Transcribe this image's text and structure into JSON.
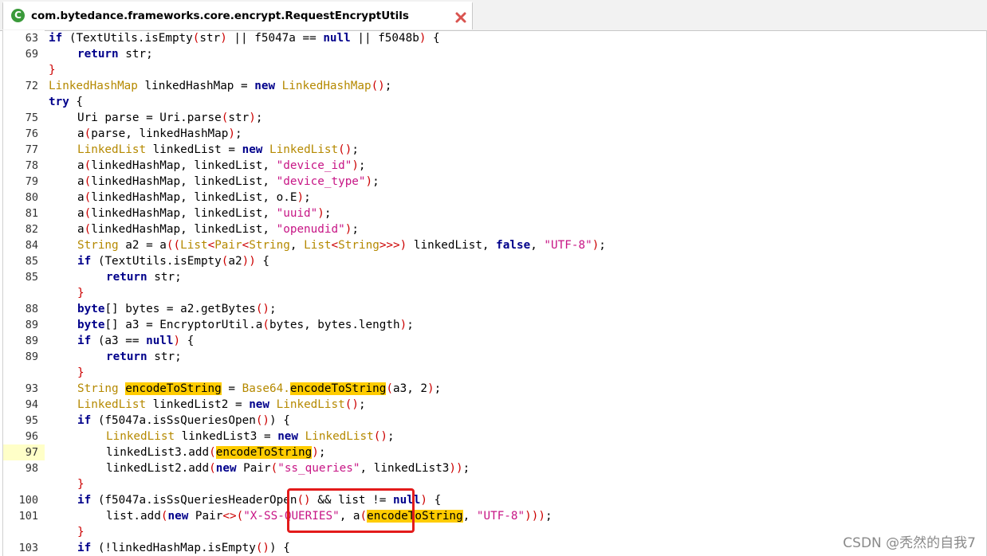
{
  "tab": {
    "title": "com.bytedance.frameworks.core.encrypt.RequestEncryptUtils",
    "icon": "class-icon",
    "close_icon": "close-icon"
  },
  "watermark": "CSDN @秃然的自我7",
  "colors": {
    "keyword": "#00008b",
    "type": "#b58900",
    "string": "#c71585",
    "highlight": "#ffcc00",
    "annotation_box": "#e31b1b"
  },
  "lines": [
    {
      "ln": "63",
      "i": 2,
      "t": [
        [
          "kw",
          "if"
        ],
        [
          "pl",
          " ("
        ],
        [
          "pl",
          "TextUtils.isEmpty"
        ],
        [
          "br",
          "("
        ],
        [
          "pl",
          "str"
        ],
        [
          "br",
          ")"
        ],
        [
          "pl",
          " || f5047a == "
        ],
        [
          "kw",
          "null"
        ],
        [
          "pl",
          " || f5048b"
        ],
        [
          "br",
          ")"
        ],
        [
          "pl",
          " {"
        ]
      ]
    },
    {
      "ln": "69",
      "i": 3,
      "t": [
        [
          "kw",
          "return"
        ],
        [
          "pl",
          " str;"
        ]
      ]
    },
    {
      "ln": "",
      "i": 2,
      "t": [
        [
          "br",
          "}"
        ]
      ]
    },
    {
      "ln": "72",
      "i": 2,
      "t": [
        [
          "ty",
          "LinkedHashMap"
        ],
        [
          "pl",
          " linkedHashMap = "
        ],
        [
          "kw",
          "new"
        ],
        [
          "pl",
          " "
        ],
        [
          "ty",
          "LinkedHashMap"
        ],
        [
          "br",
          "()"
        ],
        [
          "pl",
          ";"
        ]
      ]
    },
    {
      "ln": "",
      "i": 2,
      "t": [
        [
          "kw",
          "try"
        ],
        [
          "pl",
          " {"
        ]
      ]
    },
    {
      "ln": "75",
      "i": 3,
      "t": [
        [
          "pl",
          "Uri parse = Uri.parse"
        ],
        [
          "br",
          "("
        ],
        [
          "pl",
          "str"
        ],
        [
          "br",
          ")"
        ],
        [
          "pl",
          ";"
        ]
      ]
    },
    {
      "ln": "76",
      "i": 3,
      "t": [
        [
          "pl",
          "a"
        ],
        [
          "br",
          "("
        ],
        [
          "pl",
          "parse, linkedHashMap"
        ],
        [
          "br",
          ")"
        ],
        [
          "pl",
          ";"
        ]
      ]
    },
    {
      "ln": "77",
      "i": 3,
      "t": [
        [
          "ty",
          "LinkedList"
        ],
        [
          "pl",
          " linkedList = "
        ],
        [
          "kw",
          "new"
        ],
        [
          "pl",
          " "
        ],
        [
          "ty",
          "LinkedList"
        ],
        [
          "br",
          "()"
        ],
        [
          "pl",
          ";"
        ]
      ]
    },
    {
      "ln": "78",
      "i": 3,
      "t": [
        [
          "pl",
          "a"
        ],
        [
          "br",
          "("
        ],
        [
          "pl",
          "linkedHashMap, linkedList, "
        ],
        [
          "str",
          "\"device_id\""
        ],
        [
          "br",
          ")"
        ],
        [
          "pl",
          ";"
        ]
      ]
    },
    {
      "ln": "79",
      "i": 3,
      "t": [
        [
          "pl",
          "a"
        ],
        [
          "br",
          "("
        ],
        [
          "pl",
          "linkedHashMap, linkedList, "
        ],
        [
          "str",
          "\"device_type\""
        ],
        [
          "br",
          ")"
        ],
        [
          "pl",
          ";"
        ]
      ]
    },
    {
      "ln": "80",
      "i": 3,
      "t": [
        [
          "pl",
          "a"
        ],
        [
          "br",
          "("
        ],
        [
          "pl",
          "linkedHashMap, linkedList, o.E"
        ],
        [
          "br",
          ")"
        ],
        [
          "pl",
          ";"
        ]
      ]
    },
    {
      "ln": "81",
      "i": 3,
      "t": [
        [
          "pl",
          "a"
        ],
        [
          "br",
          "("
        ],
        [
          "pl",
          "linkedHashMap, linkedList, "
        ],
        [
          "str",
          "\"uuid\""
        ],
        [
          "br",
          ")"
        ],
        [
          "pl",
          ";"
        ]
      ]
    },
    {
      "ln": "82",
      "i": 3,
      "t": [
        [
          "pl",
          "a"
        ],
        [
          "br",
          "("
        ],
        [
          "pl",
          "linkedHashMap, linkedList, "
        ],
        [
          "str",
          "\"openudid\""
        ],
        [
          "br",
          ")"
        ],
        [
          "pl",
          ";"
        ]
      ]
    },
    {
      "ln": "84",
      "i": 3,
      "t": [
        [
          "ty",
          "String"
        ],
        [
          "pl",
          " a2 = a"
        ],
        [
          "br",
          "(("
        ],
        [
          "ty",
          "List"
        ],
        [
          "br",
          "<"
        ],
        [
          "ty",
          "Pair"
        ],
        [
          "br",
          "<"
        ],
        [
          "ty",
          "String"
        ],
        [
          "pl",
          ", "
        ],
        [
          "ty",
          "List"
        ],
        [
          "br",
          "<"
        ],
        [
          "ty",
          "String"
        ],
        [
          "br",
          ">>>)"
        ],
        [
          "pl",
          " linkedList, "
        ],
        [
          "kw",
          "false"
        ],
        [
          "pl",
          ", "
        ],
        [
          "str",
          "\"UTF-8\""
        ],
        [
          "br",
          ")"
        ],
        [
          "pl",
          ";"
        ]
      ]
    },
    {
      "ln": "85",
      "i": 3,
      "t": [
        [
          "kw",
          "if"
        ],
        [
          "pl",
          " ("
        ],
        [
          "pl",
          "TextUtils.isEmpty"
        ],
        [
          "br",
          "("
        ],
        [
          "pl",
          "a2"
        ],
        [
          "br",
          "))"
        ],
        [
          "pl",
          " {"
        ]
      ]
    },
    {
      "ln": "85",
      "i": 4,
      "t": [
        [
          "kw",
          "return"
        ],
        [
          "pl",
          " str;"
        ]
      ]
    },
    {
      "ln": "",
      "i": 3,
      "t": [
        [
          "br",
          "}"
        ]
      ]
    },
    {
      "ln": "88",
      "i": 3,
      "t": [
        [
          "kw",
          "byte"
        ],
        [
          "pl",
          "[] bytes = a2.getBytes"
        ],
        [
          "br",
          "()"
        ],
        [
          "pl",
          ";"
        ]
      ]
    },
    {
      "ln": "89",
      "i": 3,
      "t": [
        [
          "kw",
          "byte"
        ],
        [
          "pl",
          "[] a3 = EncryptorUtil.a"
        ],
        [
          "br",
          "("
        ],
        [
          "pl",
          "bytes, bytes.length"
        ],
        [
          "br",
          ")"
        ],
        [
          "pl",
          ";"
        ]
      ]
    },
    {
      "ln": "89",
      "i": 3,
      "t": [
        [
          "kw",
          "if"
        ],
        [
          "pl",
          " (a3 == "
        ],
        [
          "kw",
          "null"
        ],
        [
          "br",
          ")"
        ],
        [
          "pl",
          " {"
        ]
      ]
    },
    {
      "ln": "89",
      "i": 4,
      "t": [
        [
          "kw",
          "return"
        ],
        [
          "pl",
          " str;"
        ]
      ]
    },
    {
      "ln": "",
      "i": 3,
      "t": [
        [
          "br",
          "}"
        ]
      ]
    },
    {
      "ln": "93",
      "i": 3,
      "t": [
        [
          "ty",
          "String"
        ],
        [
          "pl",
          " "
        ],
        [
          "hi",
          "encodeToString"
        ],
        [
          "pl",
          " = "
        ],
        [
          "ty",
          "Base64."
        ],
        [
          "hi",
          "encodeToString"
        ],
        [
          "br",
          "("
        ],
        [
          "pl",
          "a3, 2"
        ],
        [
          "br",
          ")"
        ],
        [
          "pl",
          ";"
        ]
      ]
    },
    {
      "ln": "94",
      "i": 3,
      "t": [
        [
          "ty",
          "LinkedList"
        ],
        [
          "pl",
          " linkedList2 = "
        ],
        [
          "kw",
          "new"
        ],
        [
          "pl",
          " "
        ],
        [
          "ty",
          "LinkedList"
        ],
        [
          "br",
          "()"
        ],
        [
          "pl",
          ";"
        ]
      ]
    },
    {
      "ln": "95",
      "i": 3,
      "t": [
        [
          "kw",
          "if"
        ],
        [
          "pl",
          " (f5047a.isSsQueriesOpen"
        ],
        [
          "br",
          "()"
        ],
        [
          "pl",
          ") {"
        ]
      ]
    },
    {
      "ln": "96",
      "i": 4,
      "t": [
        [
          "ty",
          "LinkedList"
        ],
        [
          "pl",
          " linkedList3 = "
        ],
        [
          "kw",
          "new"
        ],
        [
          "pl",
          " "
        ],
        [
          "ty",
          "LinkedList"
        ],
        [
          "br",
          "()"
        ],
        [
          "pl",
          ";"
        ]
      ]
    },
    {
      "ln": "97",
      "i": 4,
      "hl": true,
      "t": [
        [
          "pl",
          "linkedList3.add"
        ],
        [
          "br",
          "("
        ],
        [
          "hi",
          "encodeToString"
        ],
        [
          "br",
          ")"
        ],
        [
          "pl",
          ";"
        ]
      ]
    },
    {
      "ln": "98",
      "i": 4,
      "t": [
        [
          "pl",
          "linkedList2.add"
        ],
        [
          "br",
          "("
        ],
        [
          "kw",
          "new"
        ],
        [
          "pl",
          " Pair"
        ],
        [
          "br",
          "("
        ],
        [
          "str",
          "\"ss_queries\""
        ],
        [
          "pl",
          ", linkedList3"
        ],
        [
          "br",
          "))"
        ],
        [
          "pl",
          ";"
        ]
      ]
    },
    {
      "ln": "",
      "i": 3,
      "t": [
        [
          "br",
          "}"
        ]
      ]
    },
    {
      "ln": "100",
      "i": 3,
      "t": [
        [
          "kw",
          "if"
        ],
        [
          "pl",
          " (f5047a.isSsQueriesHeaderOpen"
        ],
        [
          "br",
          "()"
        ],
        [
          "pl",
          " && list != "
        ],
        [
          "kw",
          "null"
        ],
        [
          "br",
          ")"
        ],
        [
          "pl",
          " {"
        ]
      ]
    },
    {
      "ln": "101",
      "i": 4,
      "t": [
        [
          "pl",
          "list.add"
        ],
        [
          "br",
          "("
        ],
        [
          "kw",
          "new"
        ],
        [
          "pl",
          " Pair"
        ],
        [
          "br",
          "<>("
        ],
        [
          "str",
          "\"X-SS-QUERIES\""
        ],
        [
          "pl",
          ", a"
        ],
        [
          "br",
          "("
        ],
        [
          "hi",
          "encodeToString"
        ],
        [
          "pl",
          ", "
        ],
        [
          "str",
          "\"UTF-8\""
        ],
        [
          "br",
          ")))"
        ],
        [
          "pl",
          ";"
        ]
      ]
    },
    {
      "ln": "",
      "i": 3,
      "t": [
        [
          "br",
          "}"
        ]
      ]
    },
    {
      "ln": "103",
      "i": 3,
      "t": [
        [
          "kw",
          "if"
        ],
        [
          "pl",
          " (!linkedHashMap.isEmpty"
        ],
        [
          "br",
          "()"
        ],
        [
          "pl",
          ") {"
        ]
      ]
    }
  ]
}
